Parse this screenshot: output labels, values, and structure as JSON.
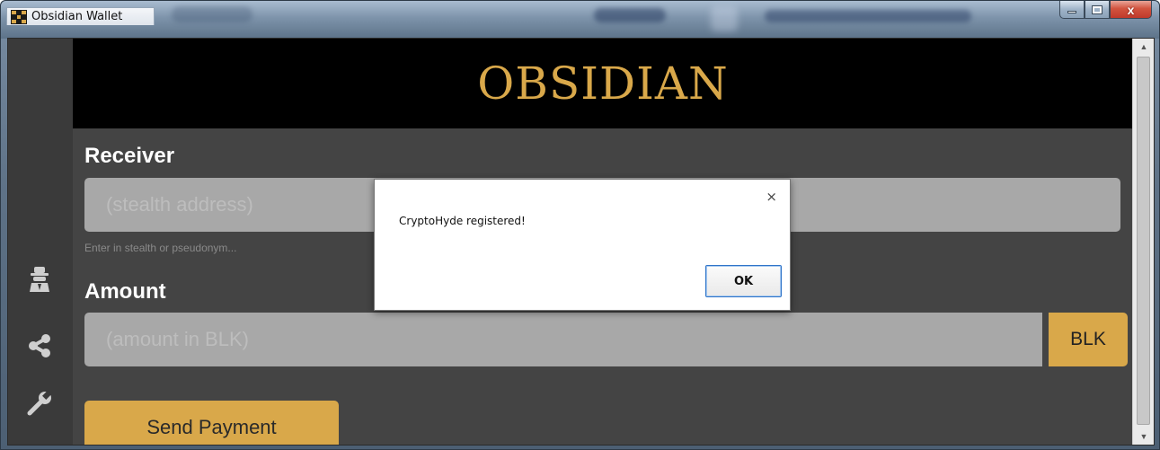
{
  "window": {
    "title": "Obsidian Wallet",
    "controls": {
      "minimize": "minimize",
      "maximize": "maximize",
      "close": "x"
    }
  },
  "header": {
    "logo": "OBSIDIAN"
  },
  "sidebar": {
    "items": [
      {
        "icon": "spy-icon"
      },
      {
        "icon": "share-icon"
      },
      {
        "icon": "wrench-icon"
      }
    ]
  },
  "form": {
    "receiver_label": "Receiver",
    "receiver_placeholder": "(stealth address)",
    "receiver_hint": "Enter in stealth or pseudonym...",
    "amount_label": "Amount",
    "amount_placeholder": "(amount in BLK)",
    "currency": "BLK",
    "send_button": "Send Payment"
  },
  "dialog": {
    "message": "CryptoHyde registered!",
    "close": "×",
    "ok": "OK"
  },
  "colors": {
    "accent": "#d9a84a",
    "background": "#444444",
    "header_bg": "#000000"
  }
}
